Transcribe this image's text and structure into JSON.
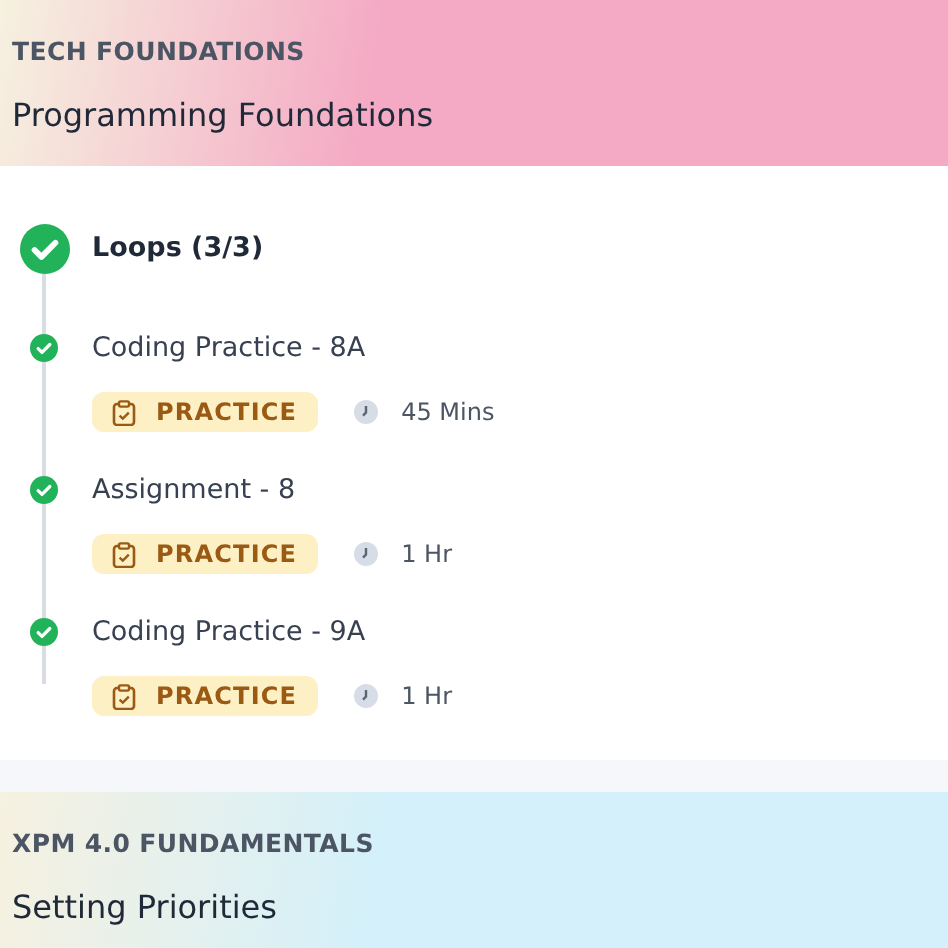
{
  "courses": [
    {
      "category": "TECH FOUNDATIONS",
      "title": "Programming Foundations",
      "color": "#f4a9c4",
      "module": {
        "title": "Loops (3/3)",
        "completed": true,
        "items": [
          {
            "title": "Coding Practice - 8A",
            "completed": true,
            "tag": "PRACTICE",
            "duration": "45 Mins"
          },
          {
            "title": "Assignment - 8",
            "completed": true,
            "tag": "PRACTICE",
            "duration": "1 Hr"
          },
          {
            "title": "Coding Practice - 9A",
            "completed": true,
            "tag": "PRACTICE",
            "duration": "1 Hr"
          }
        ]
      }
    },
    {
      "category": "XPM 4.0 FUNDAMENTALS",
      "title": "Setting Priorities",
      "color": "#d4f0fa"
    }
  ]
}
